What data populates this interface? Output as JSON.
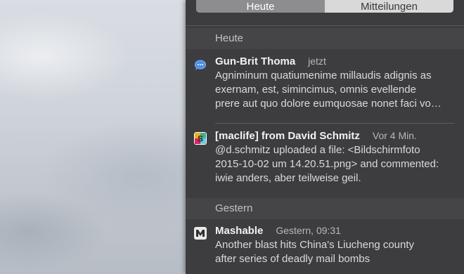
{
  "tabs": [
    {
      "label": "Heute",
      "active": true
    },
    {
      "label": "Mitteilungen",
      "active": false
    }
  ],
  "sections": [
    {
      "title": "Heute",
      "notifications": [
        {
          "icon": "messages-icon",
          "sender": "Gun-Brit Thoma",
          "time": "jetzt",
          "body_lines": [
            "Agniminum quatiumenime millaudis adignis as",
            "exernam, est, simincimus, omnis evellende",
            "prere aut quo dolore eumquosae nonet faci vo…"
          ]
        },
        {
          "icon": "slack-icon",
          "sender": "[maclife] from David Schmitz",
          "time": "Vor 4 Min.",
          "body_lines": [
            "@d.schmitz uploaded a file: <Bildschirmfoto",
            "2015-10-02 um 14.20.51.png> and commented:",
            "iwie anders, aber teilweise geil."
          ]
        }
      ]
    },
    {
      "title": "Gestern",
      "notifications": [
        {
          "icon": "mashable-icon",
          "sender": "Mashable",
          "time": "Gestern, 09:31",
          "body_lines": [
            "Another blast hits China's Liucheng county",
            "after series of deadly mail bombs"
          ]
        }
      ]
    }
  ],
  "colors": {
    "panel_bg": "#3d3d3f",
    "section_header_bg": "#454547",
    "active_tab": "#8d8d8f",
    "inactive_tab": "#d9d9da",
    "messages_blue": "#4a8fe8"
  }
}
